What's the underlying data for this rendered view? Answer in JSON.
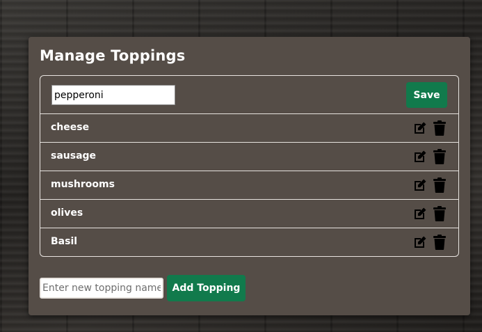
{
  "panel": {
    "title": "Manage Toppings"
  },
  "edit": {
    "value": "pepperoni",
    "save_label": "Save"
  },
  "toppings": [
    {
      "label": "cheese"
    },
    {
      "label": "sausage"
    },
    {
      "label": "mushrooms"
    },
    {
      "label": "olives"
    },
    {
      "label": "Basil"
    }
  ],
  "add": {
    "placeholder": "Enter new topping name",
    "button_label": "Add Topping"
  },
  "icons": {
    "edit": "edit-icon",
    "delete": "trash-icon"
  },
  "colors": {
    "panel": "#554d47",
    "accent": "#117a4c",
    "text": "#ffffff"
  }
}
